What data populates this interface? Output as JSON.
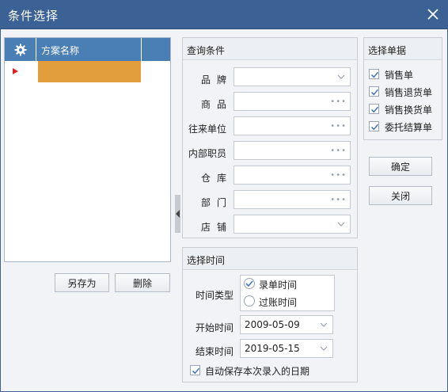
{
  "window": {
    "title": "条件选择"
  },
  "scheme_grid": {
    "column_header": "方案名称",
    "rows": [
      {
        "name": ""
      }
    ]
  },
  "left_buttons": {
    "save_as": "另存为",
    "delete": "删除"
  },
  "query": {
    "title": "查询条件",
    "fields": [
      {
        "label": "品牌",
        "type": "dropdown",
        "value": ""
      },
      {
        "label": "商品",
        "type": "lookup",
        "value": ""
      },
      {
        "label": "往来单位",
        "type": "lookup",
        "value": ""
      },
      {
        "label": "内部职员",
        "type": "lookup",
        "value": ""
      },
      {
        "label": "仓库",
        "type": "lookup",
        "value": ""
      },
      {
        "label": "部门",
        "type": "lookup",
        "value": ""
      },
      {
        "label": "店铺",
        "type": "dropdown",
        "value": ""
      }
    ]
  },
  "doc_select": {
    "title": "选择单据",
    "items": [
      {
        "label": "销售单",
        "checked": true
      },
      {
        "label": "销售退货单",
        "checked": true
      },
      {
        "label": "销售换货单",
        "checked": true
      },
      {
        "label": "委托结算单",
        "checked": true
      }
    ]
  },
  "actions": {
    "ok": "确定",
    "close": "关闭"
  },
  "time": {
    "title": "选择时间",
    "type_label": "时间类型",
    "type_options": [
      {
        "label": "录单时间",
        "selected": true
      },
      {
        "label": "过账时间",
        "selected": false
      }
    ],
    "start_label": "开始时间",
    "start_value": "2009-05-09",
    "end_label": "结束时间",
    "end_value": "2019-05-15",
    "autosave_label": "自动保存本次录入的日期",
    "autosave_checked": true
  },
  "colors": {
    "titlebar": "#3b6195",
    "grid_header": "#4a7fb5",
    "selected_row": "#e29e3c",
    "row_marker": "#e02020"
  }
}
